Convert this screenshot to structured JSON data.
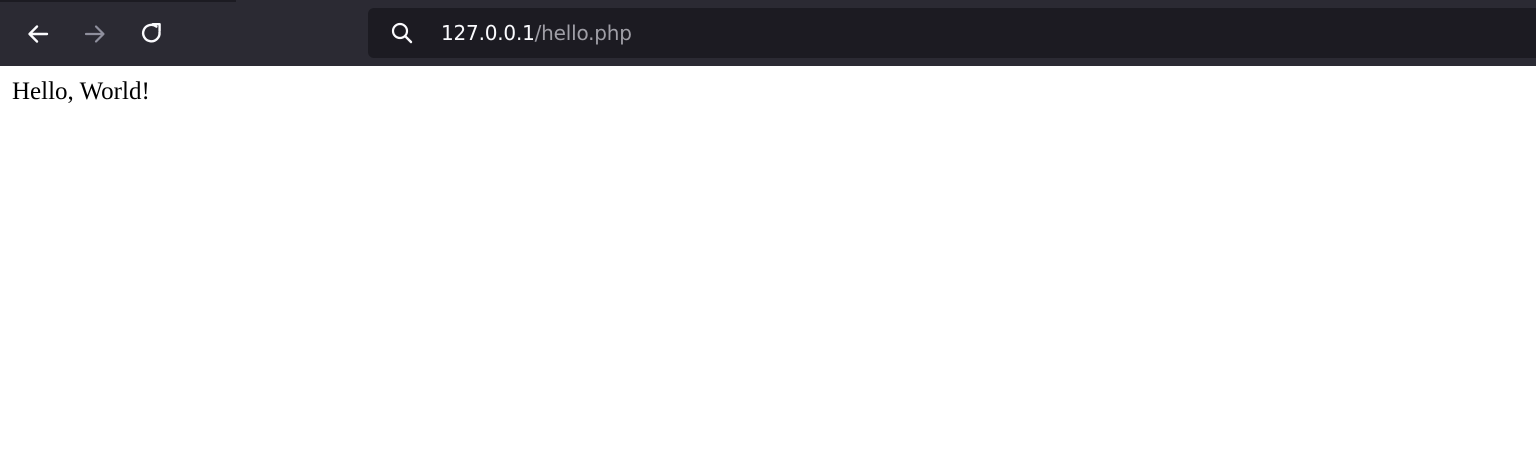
{
  "browser": {
    "toolbar": {
      "back_icon": "arrow-left-icon",
      "forward_icon": "arrow-right-icon",
      "reload_icon": "reload-icon",
      "colors": {
        "toolbar_bg": "#2b2a33",
        "urlbar_bg": "#1c1b22",
        "icon_active": "#fbfbfe",
        "icon_disabled": "#8f8f9d"
      }
    },
    "address_bar": {
      "search_icon": "search-icon",
      "host": "127.0.0.1",
      "path": "/hello.php"
    }
  },
  "page": {
    "body_text": "Hello, World!"
  }
}
